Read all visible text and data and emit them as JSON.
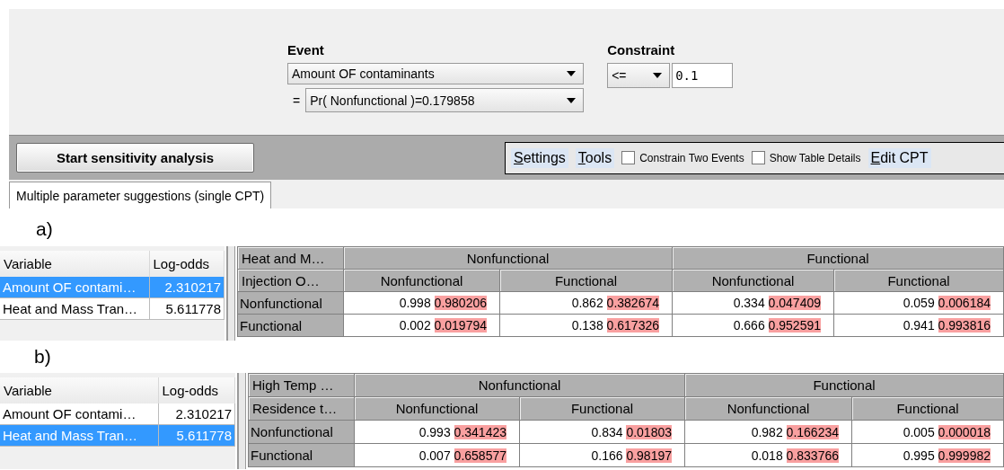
{
  "event": {
    "label": "Event",
    "variable": "Amount OF contaminants",
    "prefix": "=",
    "state": "Pr( Nonfunctional )=0.179858"
  },
  "constraint": {
    "label": "Constraint",
    "operator": "<=",
    "value": "0.1"
  },
  "toolbar": {
    "start_button": "Start sensitivity analysis",
    "menus": [
      "Settings",
      "Tools"
    ],
    "checkboxes": [
      {
        "label": "Constrain Two Events",
        "checked": false
      },
      {
        "label": "Show Table Details",
        "checked": false
      }
    ],
    "edit_menu": "Edit CPT"
  },
  "tabs": [
    {
      "label": "Multiple parameter suggestions (single CPT)",
      "selected": true
    }
  ],
  "panels": [
    {
      "caption": "a)",
      "variables": {
        "columns": [
          "Variable",
          "Log-odds"
        ],
        "rows": [
          {
            "cells": [
              "Amount OF contami…",
              "2.310217"
            ],
            "selected": true
          },
          {
            "cells": [
              "Heat and Mass Tran…",
              "5.611778"
            ],
            "selected": false
          }
        ]
      },
      "cpt": {
        "parent_label": "Heat and M…",
        "child_label": "Injection O…",
        "groups": [
          "Nonfunctional",
          "Functional"
        ],
        "states": [
          "Nonfunctional",
          "Functional",
          "Nonfunctional",
          "Functional"
        ],
        "rows": [
          {
            "label": "Nonfunctional",
            "values": [
              [
                "0.998",
                "0.980206"
              ],
              [
                "0.862",
                "0.382674"
              ],
              [
                "0.334",
                "0.047409"
              ],
              [
                "0.059",
                "0.006184"
              ]
            ]
          },
          {
            "label": "Functional",
            "values": [
              [
                "0.002",
                "0.019794"
              ],
              [
                "0.138",
                "0.617326"
              ],
              [
                "0.666",
                "0.952591"
              ],
              [
                "0.941",
                "0.993816"
              ]
            ]
          }
        ]
      }
    },
    {
      "caption": "b)",
      "variables": {
        "columns": [
          "Variable",
          "Log-odds"
        ],
        "rows": [
          {
            "cells": [
              "Amount OF contami…",
              "2.310217"
            ],
            "selected": false
          },
          {
            "cells": [
              "Heat and Mass Tran…",
              "5.611778"
            ],
            "selected": true
          }
        ]
      },
      "cpt": {
        "parent_label": "High Temp …",
        "child_label": "Residence t…",
        "groups": [
          "Nonfunctional",
          "Functional"
        ],
        "states": [
          "Nonfunctional",
          "Functional",
          "Nonfunctional",
          "Functional"
        ],
        "rows": [
          {
            "label": "Nonfunctional",
            "values": [
              [
                "0.993",
                "0.341423"
              ],
              [
                "0.834",
                "0.01803"
              ],
              [
                "0.982",
                "0.166234"
              ],
              [
                "0.005",
                "0.000018"
              ]
            ]
          },
          {
            "label": "Functional",
            "values": [
              [
                "0.007",
                "0.658577"
              ],
              [
                "0.166",
                "0.98197"
              ],
              [
                "0.018",
                "0.833766"
              ],
              [
                "0.995",
                "0.999982"
              ]
            ]
          }
        ]
      }
    }
  ]
}
